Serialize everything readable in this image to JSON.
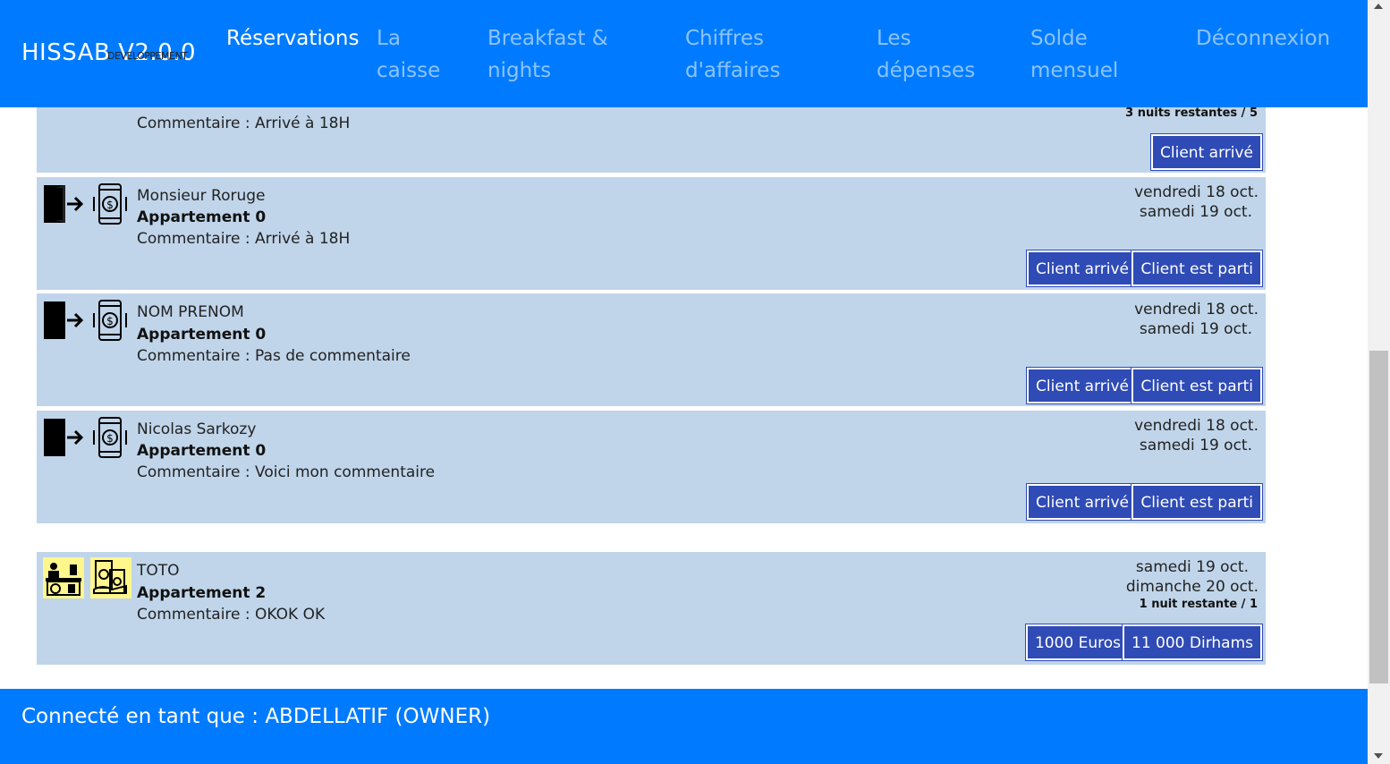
{
  "header": {
    "brand": "HISSAB V2.0.0",
    "brand_sub": "DEVELOPPEMENT",
    "nav": [
      {
        "label": "Réservations"
      },
      {
        "label": "La caisse"
      },
      {
        "label": "Breakfast & nights"
      },
      {
        "label": "Chiffres d'affaires"
      },
      {
        "label": "Les dépenses"
      },
      {
        "label": "Solde mensuel"
      },
      {
        "label": "Déconnexion"
      }
    ]
  },
  "rows": [
    {
      "comment": "Commentaire : Arrivé à 18H",
      "nights": "3 nuits restantes / 5",
      "buttons": [
        "Client arrivé"
      ]
    },
    {
      "name": "Monsieur Roruge",
      "apartment": "Appartement 0",
      "comment": "Commentaire : Arrivé à 18H",
      "date_start": "vendredi 18 oct.",
      "date_end": "samedi 19 oct.",
      "buttons": [
        "Client arrivé",
        "Client est parti"
      ]
    },
    {
      "name": "NOM PRENOM",
      "apartment": "Appartement 0",
      "comment": "Commentaire : Pas de commentaire",
      "date_start": "vendredi 18 oct.",
      "date_end": "samedi 19 oct.",
      "buttons": [
        "Client arrivé",
        "Client est parti"
      ]
    },
    {
      "name": "Nicolas Sarkozy",
      "apartment": "Appartement 0",
      "comment": "Commentaire : Voici mon commentaire",
      "date_start": "vendredi 18 oct.",
      "date_end": "samedi 19 oct.",
      "buttons": [
        "Client arrivé",
        "Client est parti"
      ]
    },
    {
      "name": "TOTO",
      "apartment": "Appartement 2",
      "comment": "Commentaire : OKOK OK",
      "date_start": "samedi 19 oct.",
      "date_end": "dimanche 20 oct.",
      "nights": "1 nuit restante / 1",
      "buttons": [
        "1000 Euros",
        "11 000 Dirhams"
      ]
    }
  ],
  "footer": {
    "text": "Connecté en tant que : ABDELLATIF (OWNER)"
  },
  "colors": {
    "header_bg": "#007bff",
    "row_bg": "#c0d5ea",
    "button_bg": "#2f4bb5",
    "highlight_icon_bg": "#fff68c"
  },
  "icons": [
    "exit-door-icon",
    "mobile-payment-icon",
    "reception-desk-icon",
    "cash-hand-icon"
  ]
}
